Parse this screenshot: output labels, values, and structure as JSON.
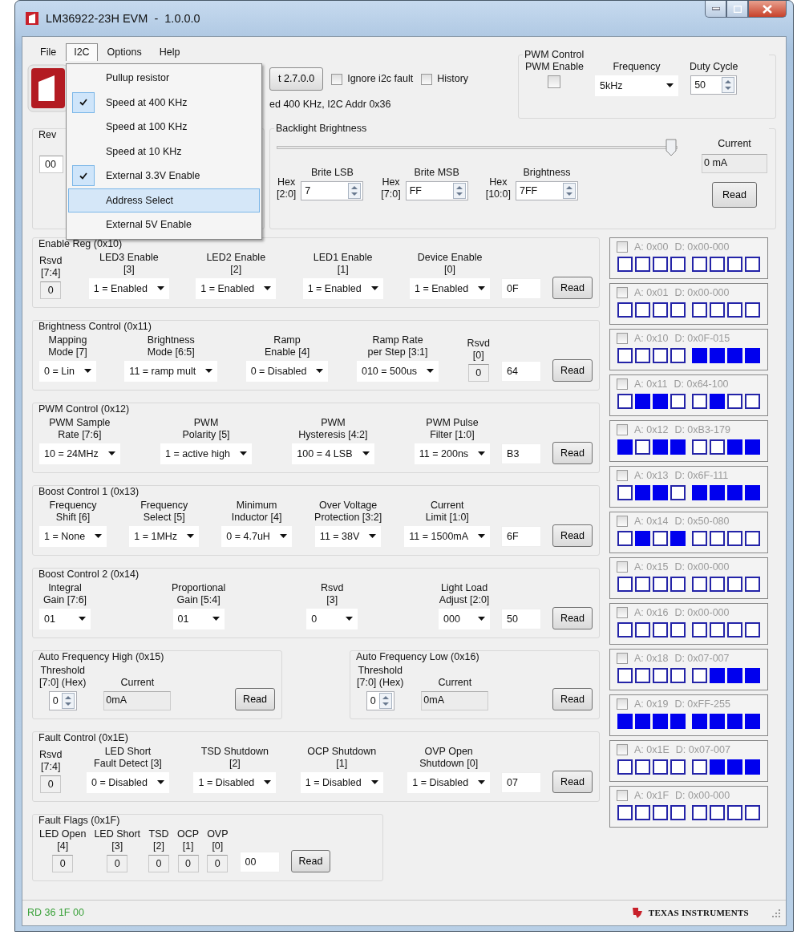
{
  "window": {
    "title": "LM36922-23H EVM  -  1.0.0.0"
  },
  "menu_bar": [
    {
      "label": "File",
      "selected": false
    },
    {
      "label": "I2C",
      "selected": true
    },
    {
      "label": "Options",
      "selected": false
    },
    {
      "label": "Help",
      "selected": false
    }
  ],
  "open_menu": {
    "items": [
      {
        "label": "Pullup resistor",
        "checked": false,
        "selected": false
      },
      {
        "label": "Speed at 400 KHz",
        "checked": true,
        "selected": false
      },
      {
        "label": "Speed at 100 KHz",
        "checked": false,
        "selected": false
      },
      {
        "label": "Speed at 10 KHz",
        "checked": false,
        "selected": false
      },
      {
        "label": "External 3.3V Enable",
        "checked": true,
        "selected": false
      },
      {
        "label": "Address Select",
        "checked": false,
        "selected": true
      },
      {
        "label": "External 5V Enable",
        "checked": false,
        "selected": false
      }
    ]
  },
  "toolbar": {
    "version_button": "t 2.7.0.0",
    "options": [
      {
        "label": "Ignore i2c fault",
        "checked": false
      },
      {
        "label": "History",
        "checked": false
      }
    ],
    "status": "ed 400 KHz, I2C Addr 0x36"
  },
  "pwm_control": {
    "title": "PWM Control",
    "enable_label": "PWM Enable",
    "enabled": false,
    "frequency_label": "Frequency",
    "frequency": "5kHz",
    "duty_cycle_label": "Duty Cycle",
    "duty_cycle": "50"
  },
  "rev": {
    "title": "Rev",
    "value": "00"
  },
  "backlight": {
    "title": "Backlight Brightness",
    "level": 1,
    "current_label": "Current",
    "current": "0 mA",
    "button": "Read",
    "fields": [
      {
        "hex_label": [
          "Hex",
          "[2:0]"
        ],
        "label": [
          "Brite LSB"
        ],
        "value": "7"
      },
      {
        "hex_label": [
          "Hex",
          "[7:0]"
        ],
        "label": [
          "Brite MSB"
        ],
        "value": "FF"
      },
      {
        "hex_label": [
          "Hex",
          "[10:0]"
        ],
        "label": [
          "Brightness"
        ],
        "value": "7FF"
      }
    ]
  },
  "register_groups": [
    {
      "kind": "register",
      "title": "Enable Reg (0x10)",
      "hex": "0F",
      "button": "Read",
      "fields": [
        {
          "kind": "readonly",
          "label": [
            "Rsvd",
            "[7:4]"
          ],
          "value": "0"
        },
        {
          "kind": "select",
          "label": [
            "LED3 Enable",
            "[3]"
          ],
          "value": "1 = Enabled"
        },
        {
          "kind": "select",
          "label": [
            "LED2 Enable",
            "[2]"
          ],
          "value": "1 = Enabled"
        },
        {
          "kind": "select",
          "label": [
            "LED1 Enable",
            "[1]"
          ],
          "value": "1 = Enabled"
        },
        {
          "kind": "select",
          "label": [
            "Device Enable",
            "[0]"
          ],
          "value": "1 = Enabled"
        }
      ]
    },
    {
      "kind": "register",
      "title": "Brightness Control (0x11)",
      "hex": "64",
      "button": "Read",
      "fields": [
        {
          "kind": "select",
          "label": [
            "Mapping",
            "Mode [7]"
          ],
          "value": "0 = Lin"
        },
        {
          "kind": "select",
          "label": [
            "Brightness",
            "Mode [6:5]"
          ],
          "value": "11 = ramp mult"
        },
        {
          "kind": "select",
          "label": [
            "Ramp",
            "Enable [4]"
          ],
          "value": "0 = Disabled"
        },
        {
          "kind": "select",
          "label": [
            "Ramp Rate",
            "per Step [3:1]"
          ],
          "value": "010 = 500us"
        },
        {
          "kind": "readonly",
          "label": [
            "Rsvd",
            "[0]"
          ],
          "value": "0"
        }
      ]
    },
    {
      "kind": "register",
      "title": "PWM Control (0x12)",
      "hex": "B3",
      "button": "Read",
      "fields": [
        {
          "kind": "select",
          "label": [
            "PWM Sample",
            "Rate [7:6]"
          ],
          "value": "10 = 24MHz"
        },
        {
          "kind": "select",
          "label": [
            "PWM",
            "Polarity [5]"
          ],
          "value": "1 = active high"
        },
        {
          "kind": "select",
          "label": [
            "PWM",
            "Hysteresis [4:2]"
          ],
          "value": "100 = 4 LSB"
        },
        {
          "kind": "select",
          "label": [
            "PWM Pulse",
            "Filter [1:0]"
          ],
          "value": "11 = 200ns"
        }
      ]
    },
    {
      "kind": "register",
      "title": "Boost Control 1 (0x13)",
      "hex": "6F",
      "button": "Read",
      "fields": [
        {
          "kind": "select",
          "label": [
            "Frequency",
            "Shift [6]"
          ],
          "value": "1 = None"
        },
        {
          "kind": "select",
          "label": [
            "Frequency",
            "Select [5]"
          ],
          "value": "1 = 1MHz"
        },
        {
          "kind": "select",
          "label": [
            "Minimum",
            "Inductor [4]"
          ],
          "value": "0 = 4.7uH"
        },
        {
          "kind": "select",
          "label": [
            "Over Voltage",
            "Protection [3:2]"
          ],
          "value": "11 = 38V"
        },
        {
          "kind": "select",
          "label": [
            "Current",
            "Limit [1:0]"
          ],
          "value": "11 = 1500mA"
        }
      ]
    },
    {
      "kind": "register",
      "title": "Boost Control 2 (0x14)",
      "hex": "50",
      "button": "Read",
      "fields": [
        {
          "kind": "select",
          "label": [
            "Integral",
            "Gain [7:6]"
          ],
          "value": "01"
        },
        {
          "kind": "select",
          "label": [
            "Proportional",
            "Gain [5:4]"
          ],
          "value": "01"
        },
        {
          "kind": "select",
          "label": [
            "Rsvd",
            "[3]"
          ],
          "value": "0"
        },
        {
          "kind": "select",
          "label": [
            "Light Load",
            "Adjust [2:0]"
          ],
          "value": "000"
        }
      ]
    },
    {
      "kind": "pair",
      "panels": [
        {
          "title": "Auto Frequency High (0x15)",
          "button": "Read",
          "fields": [
            {
              "kind": "spin",
              "label": [
                "Threshold",
                "[7:0] (Hex)"
              ],
              "value": "0"
            },
            {
              "kind": "display",
              "label": [
                "Current"
              ],
              "value": "0mA"
            }
          ]
        },
        {
          "title": "Auto Frequency Low (0x16)",
          "button": "Read",
          "fields": [
            {
              "kind": "spin",
              "label": [
                "Threshold",
                "[7:0] (Hex)"
              ],
              "value": "0"
            },
            {
              "kind": "display",
              "label": [
                "Current"
              ],
              "value": "0mA"
            }
          ]
        }
      ]
    },
    {
      "kind": "register",
      "title": "Fault Control (0x1E)",
      "hex": "07",
      "button": "Read",
      "fields": [
        {
          "kind": "readonly",
          "label": [
            "Rsvd",
            "[7:4]"
          ],
          "value": "0"
        },
        {
          "kind": "select",
          "label": [
            "LED Short",
            "Fault Detect [3]"
          ],
          "value": "0 = Disabled"
        },
        {
          "kind": "select",
          "label": [
            "TSD Shutdown",
            "[2]"
          ],
          "value": "1 = Disabled"
        },
        {
          "kind": "select",
          "label": [
            "OCP Shutdown",
            "[1]"
          ],
          "value": "1 = Disabled"
        },
        {
          "kind": "select",
          "label": [
            "OVP Open",
            "Shutdown [0]"
          ],
          "value": "1 = Disabled"
        }
      ]
    },
    {
      "kind": "flags",
      "title": "Fault Flags (0x1F)",
      "hex": "00",
      "button": "Read",
      "fields": [
        {
          "kind": "readonly",
          "label": [
            "LED Open",
            "[4]"
          ],
          "value": "0"
        },
        {
          "kind": "readonly",
          "label": [
            "LED Short",
            "[3]"
          ],
          "value": "0"
        },
        {
          "kind": "readonly",
          "label": [
            "TSD",
            "[2]"
          ],
          "value": "0"
        },
        {
          "kind": "readonly",
          "label": [
            "OCP",
            "[1]"
          ],
          "value": "0"
        },
        {
          "kind": "readonly",
          "label": [
            "OVP",
            "[0]"
          ],
          "value": "0"
        }
      ]
    }
  ],
  "monitor": [
    {
      "address": "A: 0x00",
      "data": "D: 0x00-000",
      "checked": false,
      "bits": [
        false,
        false,
        false,
        false,
        false,
        false,
        false,
        false
      ]
    },
    {
      "address": "A: 0x01",
      "data": "D: 0x00-000",
      "checked": false,
      "bits": [
        false,
        false,
        false,
        false,
        false,
        false,
        false,
        false
      ]
    },
    {
      "address": "A: 0x10",
      "data": "D: 0x0F-015",
      "checked": false,
      "bits": [
        false,
        false,
        false,
        false,
        true,
        true,
        true,
        true
      ]
    },
    {
      "address": "A: 0x11",
      "data": "D: 0x64-100",
      "checked": false,
      "bits": [
        false,
        true,
        true,
        false,
        false,
        true,
        false,
        false
      ]
    },
    {
      "address": "A: 0x12",
      "data": "D: 0xB3-179",
      "checked": false,
      "bits": [
        true,
        false,
        true,
        true,
        false,
        false,
        true,
        true
      ]
    },
    {
      "address": "A: 0x13",
      "data": "D: 0x6F-111",
      "checked": false,
      "bits": [
        false,
        true,
        true,
        false,
        true,
        true,
        true,
        true
      ]
    },
    {
      "address": "A: 0x14",
      "data": "D: 0x50-080",
      "checked": false,
      "bits": [
        false,
        true,
        false,
        true,
        false,
        false,
        false,
        false
      ]
    },
    {
      "address": "A: 0x15",
      "data": "D: 0x00-000",
      "checked": false,
      "bits": [
        false,
        false,
        false,
        false,
        false,
        false,
        false,
        false
      ]
    },
    {
      "address": "A: 0x16",
      "data": "D: 0x00-000",
      "checked": false,
      "bits": [
        false,
        false,
        false,
        false,
        false,
        false,
        false,
        false
      ]
    },
    {
      "address": "A: 0x18",
      "data": "D: 0x07-007",
      "checked": false,
      "bits": [
        false,
        false,
        false,
        false,
        false,
        true,
        true,
        true
      ]
    },
    {
      "address": "A: 0x19",
      "data": "D: 0xFF-255",
      "checked": false,
      "bits": [
        true,
        true,
        true,
        true,
        true,
        true,
        true,
        true
      ]
    },
    {
      "address": "A: 0x1E",
      "data": "D: 0x07-007",
      "checked": false,
      "bits": [
        false,
        false,
        false,
        false,
        false,
        true,
        true,
        true
      ]
    },
    {
      "address": "A: 0x1F",
      "data": "D: 0x00-000",
      "checked": false,
      "bits": [
        false,
        false,
        false,
        false,
        false,
        false,
        false,
        false
      ]
    }
  ],
  "status_bar": {
    "text": "RD 36 1F 00",
    "brand": "TEXAS INSTRUMENTS"
  }
}
